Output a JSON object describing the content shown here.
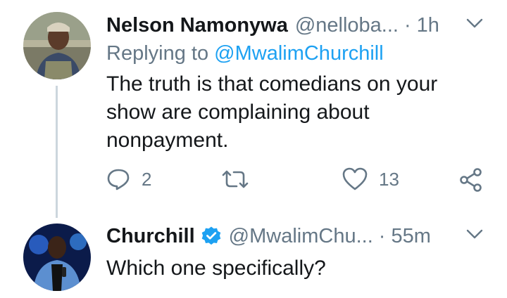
{
  "tweets": [
    {
      "name": "Nelson Namonywa",
      "handle": "@nelloba...",
      "separator": "·",
      "time": "1h",
      "reply_prefix": "Replying to",
      "reply_to": "@MwalimChurchill",
      "text": "The truth is that comedians on your show are complaining about nonpayment.",
      "stats": {
        "replies": "2",
        "likes": "13"
      },
      "icons": {
        "caret": "chevron-down-icon",
        "reply": "reply-icon",
        "retweet": "retweet-icon",
        "like": "heart-icon",
        "share": "share-icon"
      }
    },
    {
      "name": "Churchill",
      "verified": true,
      "handle": "@MwalimChu...",
      "separator": "·",
      "time": "55m",
      "text": "Which one specifically?",
      "icons": {
        "caret": "chevron-down-icon",
        "verified": "verified-badge-icon"
      }
    }
  ],
  "colors": {
    "accent": "#1da1f2",
    "muted": "#657786",
    "text": "#14171a",
    "thread_line": "#ccd6dd"
  }
}
